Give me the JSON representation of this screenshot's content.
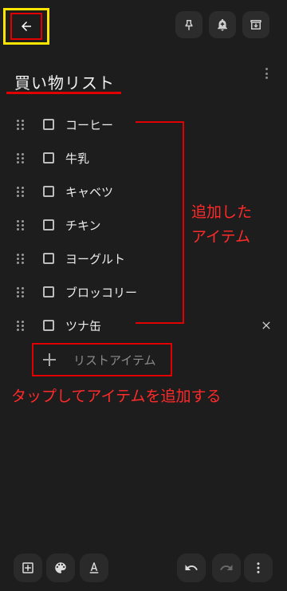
{
  "note": {
    "title": "買い物リスト"
  },
  "items": [
    {
      "label": "コーヒー",
      "checked": false
    },
    {
      "label": "牛乳",
      "checked": false
    },
    {
      "label": "キャベツ",
      "checked": false
    },
    {
      "label": "チキン",
      "checked": false
    },
    {
      "label": "ヨーグルト",
      "checked": false
    },
    {
      "label": "ブロッコリー",
      "checked": false
    },
    {
      "label": "ツナ缶",
      "checked": false
    }
  ],
  "add_item": {
    "label": "リストアイテム"
  },
  "annotations": {
    "added_line1": "追加した",
    "added_line2": "アイテム",
    "tap_hint": "タップしてアイテムを追加する"
  },
  "icons": {
    "back": "arrow-back-icon",
    "pin": "pin-icon",
    "reminder": "bell-plus-icon",
    "archive": "archive-icon",
    "more": "more-vertical-icon",
    "add_box": "add-box-icon",
    "palette": "palette-icon",
    "text_format": "text-format-icon",
    "undo": "undo-icon",
    "redo": "redo-icon"
  },
  "colors": {
    "background": "#1d1d1d",
    "annotation": "#e00000",
    "highlight": "#ffe600"
  }
}
